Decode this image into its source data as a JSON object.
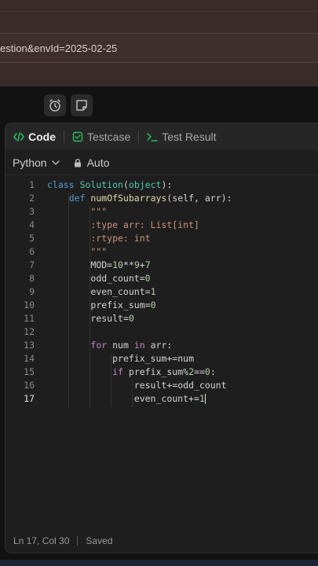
{
  "browser": {
    "url_text": "estion&envId=2025-02-25"
  },
  "tabs": [
    {
      "label": "Code",
      "icon": "code-icon"
    },
    {
      "label": "Testcase",
      "icon": "checkbox-icon"
    },
    {
      "label": "Test Result",
      "icon": "terminal-icon"
    }
  ],
  "toolbar": {
    "language": "Python",
    "mode": "Auto"
  },
  "editor": {
    "lines": [
      "class Solution(object):",
      "    def numOfSubarrays(self, arr):",
      "        \"\"\"",
      "        :type arr: List[int]",
      "        :rtype: int",
      "        \"\"\"",
      "        MOD=10**9+7",
      "        odd_count=0",
      "        even_count=1",
      "        prefix_sum=0",
      "        result=0",
      "",
      "        for num in arr:",
      "            prefix_sum+=num",
      "            if prefix_sum%2==0:",
      "                result+=odd_count",
      "                even_count+=1"
    ],
    "line_numbers": [
      "1",
      "2",
      "3",
      "4",
      "5",
      "6",
      "7",
      "8",
      "9",
      "10",
      "11",
      "12",
      "13",
      "14",
      "15",
      "16",
      "17"
    ],
    "current_line": 17
  },
  "status": {
    "position": "Ln 17, Col 30",
    "state": "Saved"
  },
  "colors": {
    "keyword": "#c586c0",
    "def_keyword": "#569cd6",
    "class_name": "#4ec9b0",
    "function_name": "#dcdcaa",
    "string": "#ce9178",
    "number": "#b5cea8",
    "code_tab_accent": "#2cbb5d"
  }
}
